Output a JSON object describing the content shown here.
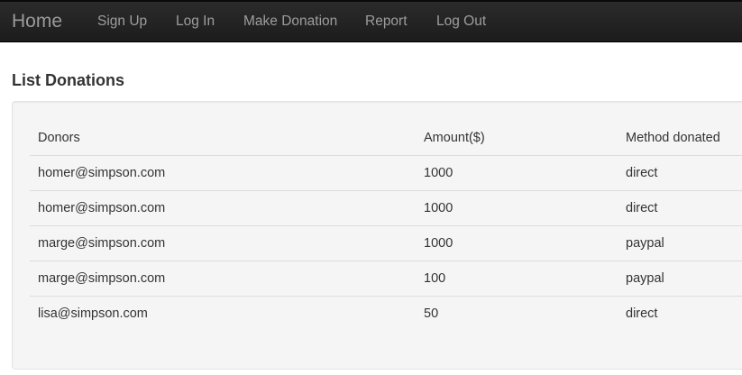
{
  "nav": {
    "brand": "Home",
    "links": [
      "Sign Up",
      "Log In",
      "Make Donation",
      "Report",
      "Log Out"
    ]
  },
  "page": {
    "title": "List Donations"
  },
  "table": {
    "headers": [
      "Donors",
      "Amount($)",
      "Method donated"
    ],
    "rows": [
      [
        "homer@simpson.com",
        "1000",
        "direct"
      ],
      [
        "homer@simpson.com",
        "1000",
        "direct"
      ],
      [
        "marge@simpson.com",
        "1000",
        "paypal"
      ],
      [
        "marge@simpson.com",
        "100",
        "paypal"
      ],
      [
        "lisa@simpson.com",
        "50",
        "direct"
      ]
    ]
  }
}
